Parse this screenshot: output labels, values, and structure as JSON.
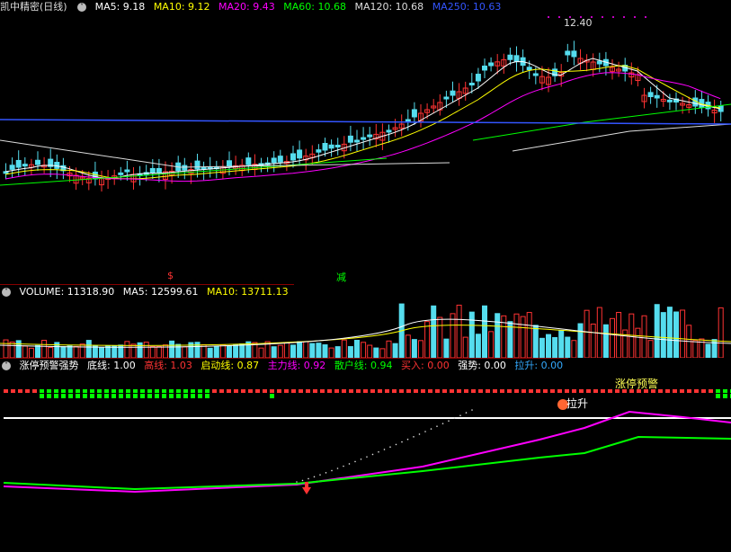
{
  "main": {
    "title": "凯中精密(日线)",
    "indicators": [
      {
        "label": "MA5: 9.18",
        "color": "#ffffff"
      },
      {
        "label": "MA10: 9.12",
        "color": "#ffff00"
      },
      {
        "label": "MA20: 9.43",
        "color": "#ff00ff"
      },
      {
        "label": "MA60: 10.68",
        "color": "#00ff00"
      },
      {
        "label": "MA120: 10.68",
        "color": "#dddddd"
      },
      {
        "label": "MA250: 10.63",
        "color": "#3355ff"
      }
    ],
    "high_label": "12.40",
    "marker_left": "$",
    "marker_mid": "减"
  },
  "volume": {
    "indicators": [
      {
        "label": "VOLUME: 11318.90",
        "color": "#ffffff"
      },
      {
        "label": "MA5: 12599.61",
        "color": "#ffffff"
      },
      {
        "label": "MA10: 13711.13",
        "color": "#ffff00"
      }
    ]
  },
  "signal": {
    "title": "涨停预警强势",
    "indicators": [
      {
        "label": "底线: 1.00",
        "color": "#ffffff"
      },
      {
        "label": "高线: 1.03",
        "color": "#ff3333"
      },
      {
        "label": "启动线: 0.87",
        "color": "#ffff00"
      },
      {
        "label": "主力线: 0.92",
        "color": "#ff00ff"
      },
      {
        "label": "散户线: 0.94",
        "color": "#00ff00"
      },
      {
        "label": "买入: 0.00",
        "color": "#ff3333"
      },
      {
        "label": "强势: 0.00",
        "color": "#ffffff"
      },
      {
        "label": "拉升: 0.00",
        "color": "#33aaff"
      }
    ],
    "warning_label": "涨停预警",
    "pull_label": "拉升"
  },
  "colors": {
    "up": "#ff3333",
    "down": "#55ddee",
    "bg": "#000000"
  }
}
